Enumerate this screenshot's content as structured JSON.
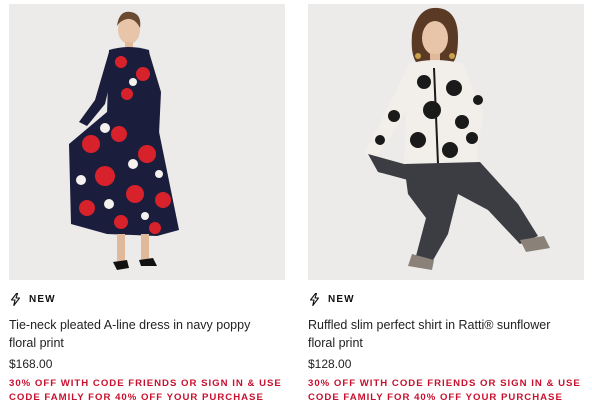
{
  "products": [
    {
      "badge": "NEW",
      "title": "Tie-neck pleated A-line dress in navy poppy floral print",
      "price": "$168.00",
      "promo": "30% OFF WITH CODE FRIENDS OR SIGN IN & USE CODE FAMILY FOR 40% OFF YOUR PURCHASE"
    },
    {
      "badge": "NEW",
      "title": "Ruffled slim perfect shirt in Ratti® sunflower floral print",
      "price": "$128.00",
      "promo": "30% OFF WITH CODE FRIENDS OR SIGN IN & USE CODE FAMILY FOR 40% OFF YOUR PURCHASE"
    }
  ],
  "icons": {
    "badge": "lightning-bolt-icon"
  },
  "colors": {
    "promo": "#c8102e",
    "photo_bg": "#ecebea"
  }
}
